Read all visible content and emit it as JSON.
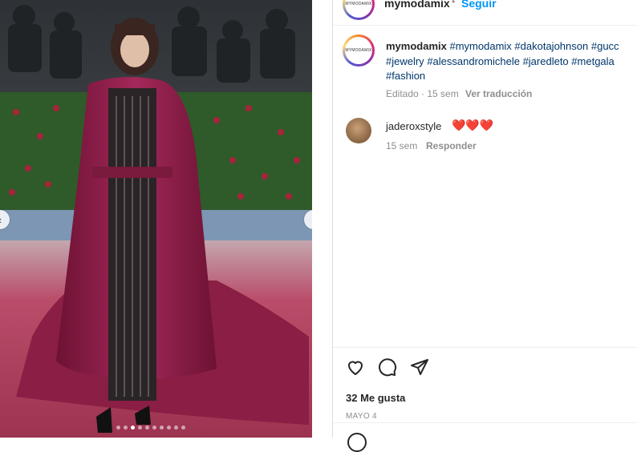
{
  "post": {
    "photo": {
      "colors": {
        "background": "#3f4448",
        "hedge": "#2f5a2a",
        "carpet": "#b94d6a",
        "gown": "#8a1e44"
      },
      "slide_count": 10,
      "active_slide": 2
    },
    "header": {
      "username": "mymodamix",
      "separator": "•",
      "follow_label": "Seguir",
      "avatar_text": "MYMODAMIX"
    },
    "caption": {
      "username": "mymodamix",
      "avatar_text": "MYMODAMIX",
      "hashtags": [
        "#mymodamix",
        "#dakotajohnson",
        "#gucc",
        "#jewelry",
        "#alessandromichele",
        "#jaredleto",
        "#metgala",
        "#fashion"
      ],
      "meta": "Editado · 15 sem",
      "translate_label": "Ver traducción"
    },
    "comments": [
      {
        "username": "jaderoxstyle",
        "text": "❤️❤️❤️",
        "time": "15 sem",
        "reply_label": "Responder"
      }
    ],
    "actions": {
      "like_icon": "heart-icon",
      "comment_icon": "comment-icon",
      "share_icon": "share-icon"
    },
    "likes": "32 Me gusta",
    "date": "MAYO 4"
  }
}
